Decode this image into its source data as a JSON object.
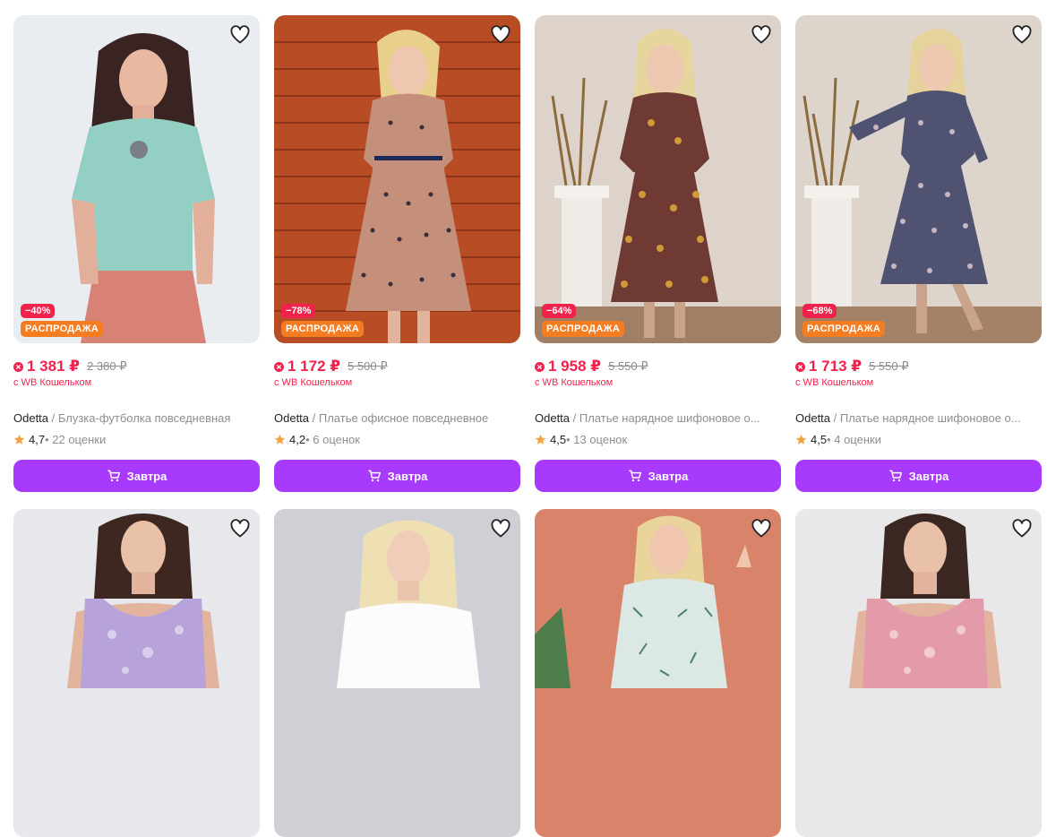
{
  "colors": {
    "accent": "#a73afd",
    "discount": "#f1234d",
    "sale_badge": "#f47d22",
    "star": "#f4a340"
  },
  "products": [
    {
      "discount": "−40%",
      "sale_label": "РАСПРОДАЖА",
      "price": "1 381 ₽",
      "old_price": "2 380 ₽",
      "wallet": "с WB Кошельком",
      "brand": "Odetta",
      "name": " / Блузка-футболка повседневная",
      "rating": "4,7",
      "reviews": " • 22 оценки",
      "cart_label": "Завтра"
    },
    {
      "discount": "−78%",
      "sale_label": "РАСПРОДАЖА",
      "price": "1 172 ₽",
      "old_price": "5 500 ₽",
      "wallet": "с WB Кошельком",
      "brand": "Odetta",
      "name": " / Платье офисное повседневное",
      "rating": "4,2",
      "reviews": " • 6 оценок",
      "cart_label": "Завтра"
    },
    {
      "discount": "−64%",
      "sale_label": "РАСПРОДАЖА",
      "price": "1 958 ₽",
      "old_price": "5 550 ₽",
      "wallet": "с WB Кошельком",
      "brand": "Odetta",
      "name": " / Платье нарядное шифоновое о...",
      "rating": "4,5",
      "reviews": " • 13 оценок",
      "cart_label": "Завтра"
    },
    {
      "discount": "−68%",
      "sale_label": "РАСПРОДАЖА",
      "price": "1 713 ₽",
      "old_price": "5 550 ₽",
      "wallet": "с WB Кошельком",
      "brand": "Odetta",
      "name": " / Платье нарядное шифоновое о...",
      "rating": "4,5",
      "reviews": " • 4 оценки",
      "cart_label": "Завтра"
    }
  ]
}
